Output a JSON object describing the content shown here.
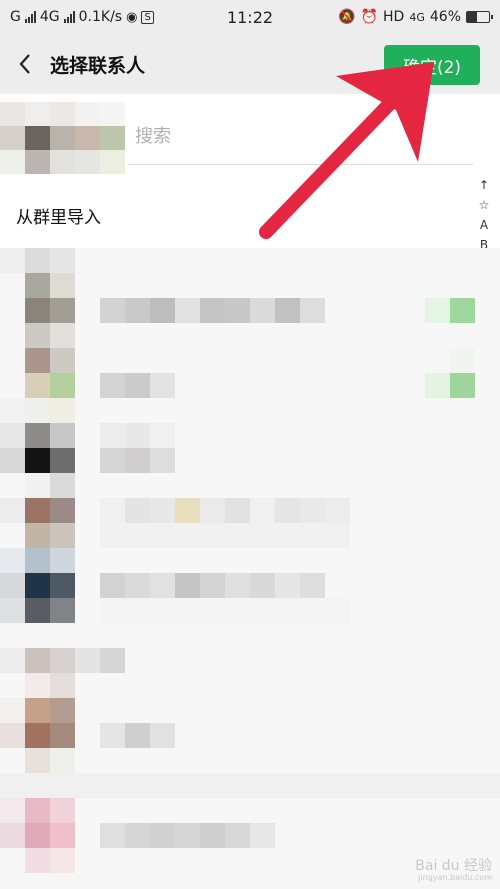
{
  "status_bar": {
    "carrier_left": "G",
    "network_4g": "4G",
    "speed": "0.1K/s",
    "time": "11:22",
    "hd": "HD",
    "net_4g2": "4G",
    "battery": "46%",
    "battery_level": 0.46,
    "icons": [
      "signal-icon",
      "wechat-icon",
      "s-badge-icon",
      "mute-icon",
      "alarm-icon",
      "battery-icon"
    ]
  },
  "header": {
    "title": "选择联系人",
    "confirm_label": "确定(2)",
    "back_icon": "chevron-left-icon"
  },
  "search": {
    "placeholder": "搜索"
  },
  "group_import_label": "从群里导入",
  "index_bar": [
    "↑",
    "☆",
    "A",
    "B"
  ],
  "colors": {
    "accent": "#21b05a",
    "header_bg": "#ededed",
    "arrow": "#e52641"
  },
  "watermark": {
    "brand": "Bai du 经验",
    "url": "jingyan.baidu.com"
  }
}
